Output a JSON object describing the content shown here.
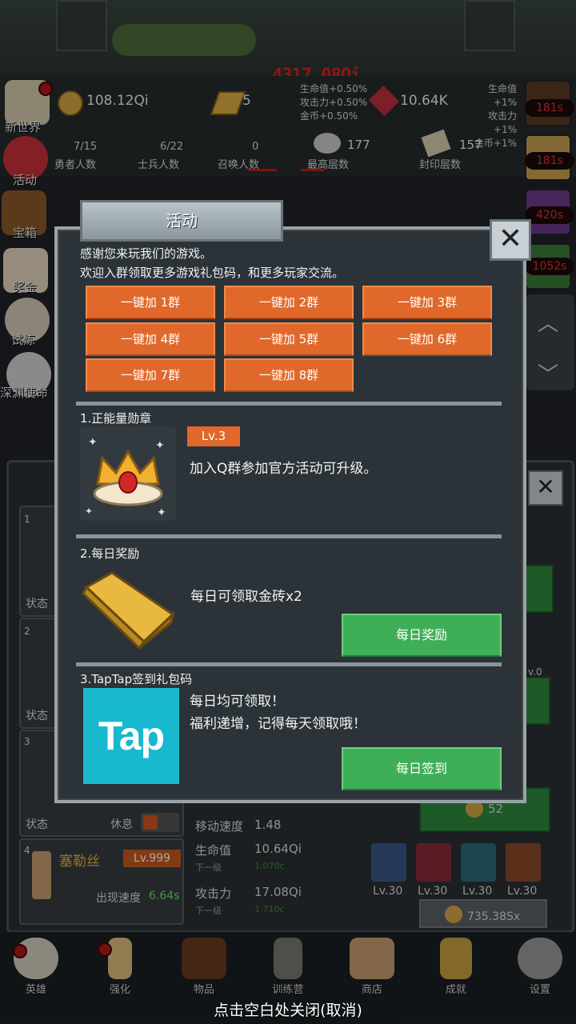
{
  "hud": {
    "damage_text": "4317.08Qi",
    "gold_value": "108.12Qi",
    "bars_value": "5",
    "gem_value": "10.64K",
    "boost_left": [
      "生命值+0.50%",
      "攻击力+0.50%",
      "金币+0.50%"
    ],
    "boost_right": [
      "生命值+1%",
      "攻击力+1%",
      "金币+1%"
    ],
    "hero_count": "7/15",
    "hero_label": "勇者人数",
    "soldier_count": "6/22",
    "soldier_label": "士兵人数",
    "summon_count": "0",
    "summon_label": "召唤人数",
    "max_floor": "177",
    "max_floor_label": "最高层数",
    "seal_floor": "157",
    "seal_floor_label": "封印层数"
  },
  "left_menu": [
    "新世界",
    "活动",
    "宝箱",
    "奖金",
    "试炼",
    "深渊使命"
  ],
  "right_timers": [
    "181s",
    "181s",
    "420s",
    "1052s"
  ],
  "hero_panel": {
    "row1_num": "1",
    "row2_num": "2",
    "row3_num": "3",
    "row4_num": "4",
    "status_label": "状态",
    "rest_label": "休息",
    "move_speed_label": "移动速度",
    "move_speed_value": "1.48",
    "hero_name": "塞勒丝",
    "hero_level": "Lv.999",
    "appear_speed_label": "出现速度",
    "appear_speed_value": "6.64s",
    "hp_label": "生命值",
    "hp_value": "10.64Qi",
    "next_label": "下一级",
    "hp_next": "1.070c",
    "atk_label": "攻击力",
    "atk_value": "17.08Qi",
    "atk_next": "1.710c",
    "skill_levels": [
      "Lv.30",
      "Lv.30",
      "Lv.30",
      "Lv.30"
    ],
    "coin_small": "52",
    "coin_cost": "735.38Sx",
    "right_lv": "v.0"
  },
  "modal": {
    "title": "活动",
    "close": "✕",
    "intro_line1": "感谢您来玩我们的游戏。",
    "intro_line2": "欢迎入群领取更多游戏礼包码，和更多玩家交流。",
    "group_buttons": [
      "一键加 1群",
      "一键加 2群",
      "一键加 3群",
      "一键加 4群",
      "一键加 5群",
      "一键加 6群",
      "一键加 7群",
      "一键加 8群"
    ],
    "sec1_title": "1.正能量勋章",
    "sec1_level": "Lv.3",
    "sec1_desc": "加入Q群参加官方活动可升级。",
    "sec2_title": "2.每日奖励",
    "sec2_desc": "每日可领取金砖x2",
    "sec2_button": "每日奖励",
    "sec3_title": "3.TapTap签到礼包码",
    "sec3_desc1": "每日均可领取！",
    "sec3_desc2": "福利递增，记得每天领取哦！",
    "sec3_button": "每日签到",
    "tap_logo": "Tap"
  },
  "nav": [
    "英雄",
    "强化",
    "物品",
    "训练营",
    "商店",
    "成就",
    "设置"
  ],
  "hint": "点击空白处关闭(取消)"
}
